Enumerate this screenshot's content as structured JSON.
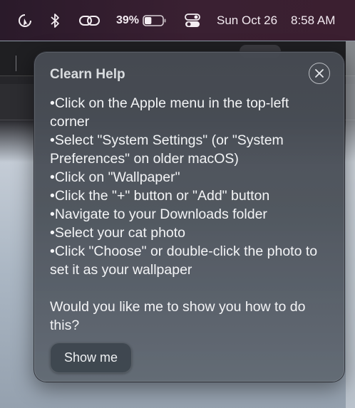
{
  "menubar": {
    "icons": [
      "cursor-refresh-icon",
      "bluetooth-icon",
      "link-icon",
      "battery-icon",
      "control-center-icon"
    ],
    "battery_percent": "39%",
    "battery_level": 0.39,
    "date": "Sun Oct 26",
    "time": "8:58 AM"
  },
  "popover": {
    "title": "Clearn Help",
    "close_icon": "close-icon",
    "steps": [
      "Click on the Apple menu in the top-left corner",
      "Select \"System Settings\" (or \"System Preferences\" on older macOS)",
      "Click on \"Wallpaper\"",
      "Click the \"+\" button or \"Add\" button",
      "Navigate to your Downloads folder",
      "Select your cat photo",
      "Click \"Choose\" or double-click the photo to set it as your wallpaper"
    ],
    "question": "Would you like me to show you how to do this?",
    "button_label": "Show me"
  }
}
